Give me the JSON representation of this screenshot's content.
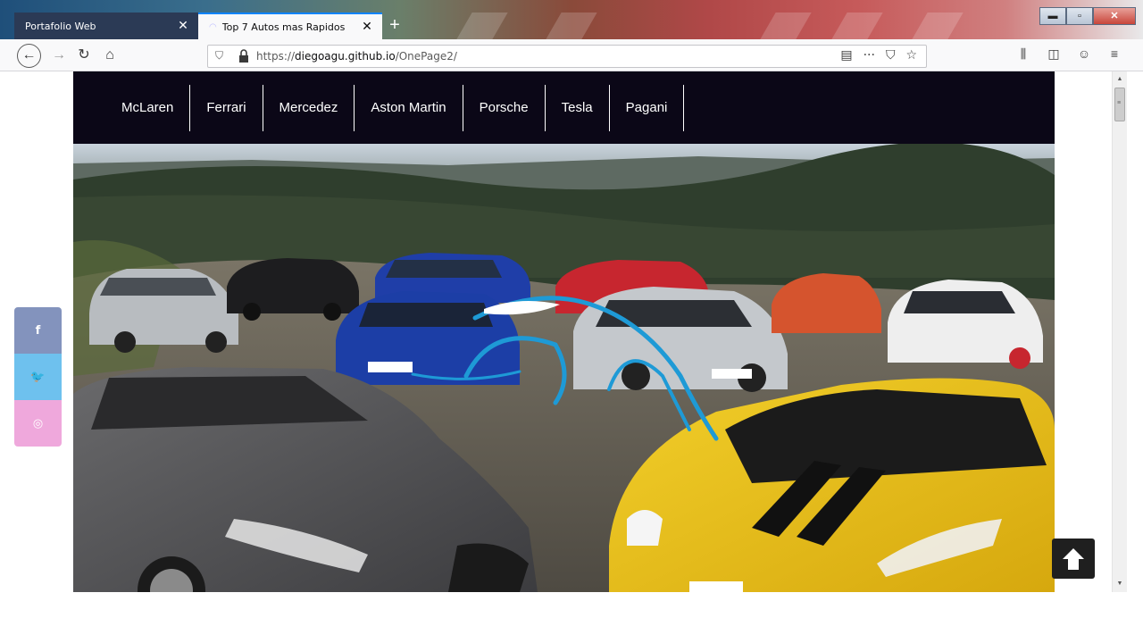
{
  "browser": {
    "tabs": [
      {
        "title": "Portafolio Web",
        "active": false
      },
      {
        "title": "Top 7 Autos mas Rapidos",
        "active": true
      }
    ],
    "close_glyph": "✕",
    "newtab_glyph": "+",
    "window_buttons": {
      "minimize": "▬",
      "maximize": "▫",
      "close": "✕"
    },
    "url": {
      "scheme": "https://",
      "host": "diegoagu.github.io",
      "path": "/OnePage2/"
    },
    "icons": {
      "back": "back-arrow-icon",
      "forward": "forward-arrow-icon",
      "reload": "reload-icon",
      "home": "home-icon",
      "reader": "reader-view-icon",
      "more": "more-actions-icon",
      "pocket": "pocket-icon",
      "bookmark": "bookmark-star-icon",
      "library": "library-icon",
      "sidebar": "sidebar-icon",
      "account": "account-icon",
      "menu": "hamburger-menu-icon"
    }
  },
  "nav": {
    "items": [
      "McLaren",
      "Ferrari",
      "Mercedez",
      "Aston Martin",
      "Porsche",
      "Tesla",
      "Pagani"
    ]
  },
  "social": {
    "facebook": "f",
    "twitter": "🐦",
    "instagram": "◎"
  },
  "colors": {
    "navbar": "#0b0717",
    "facebook": "#8393bd",
    "twitter": "#6ec1ee",
    "instagram": "#efa8dc",
    "logo_swoosh": "#1e9ad6"
  }
}
